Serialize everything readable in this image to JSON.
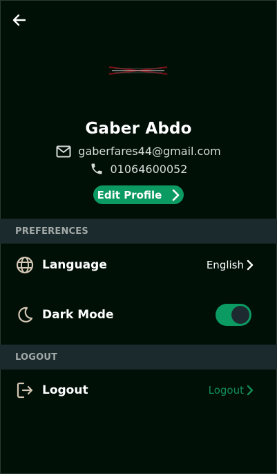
{
  "profile": {
    "name": "Gaber Abdo",
    "email": "gaberfares44@gmail.com",
    "phone": "01064600052",
    "edit_label": "Edit Profile"
  },
  "sections": {
    "preferences": "PREFERENCES",
    "logout": "LOGOUT"
  },
  "preferences": {
    "language_label": "Language",
    "language_value": "English",
    "dark_mode_label": "Dark Mode",
    "dark_mode_on": true
  },
  "logout": {
    "label": "Logout",
    "value": "Logout"
  },
  "colors": {
    "background": "#011007",
    "accent": "#0c9a63",
    "section_bg": "#1b2a2c",
    "logout_value": "#128d57"
  },
  "icons": [
    "back-arrow-icon",
    "mail-icon",
    "phone-icon",
    "chevron-right-icon",
    "globe-icon",
    "moon-icon",
    "logout-icon"
  ]
}
